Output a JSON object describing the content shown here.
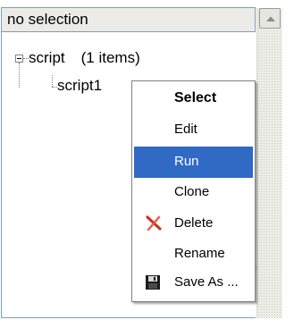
{
  "header": {
    "selection_text": "no selection"
  },
  "tree": {
    "root_label": "script",
    "root_count": "(1 items)",
    "child_label": "script1"
  },
  "context_menu": {
    "items": [
      {
        "label": "Select",
        "icon": "",
        "style": "bold"
      },
      {
        "label": "Edit",
        "icon": ""
      },
      {
        "label": "Run",
        "icon": "",
        "highlighted": true
      },
      {
        "label": "Clone",
        "icon": ""
      },
      {
        "label": "Delete",
        "icon": "red-x-icon"
      },
      {
        "label": "Rename",
        "icon": ""
      },
      {
        "label": "Save As ...",
        "icon": "floppy-disk-icon"
      }
    ]
  },
  "colors": {
    "highlight": "#316ac5",
    "delete_icon": "#d23c2a",
    "border": "#7f9db9"
  }
}
